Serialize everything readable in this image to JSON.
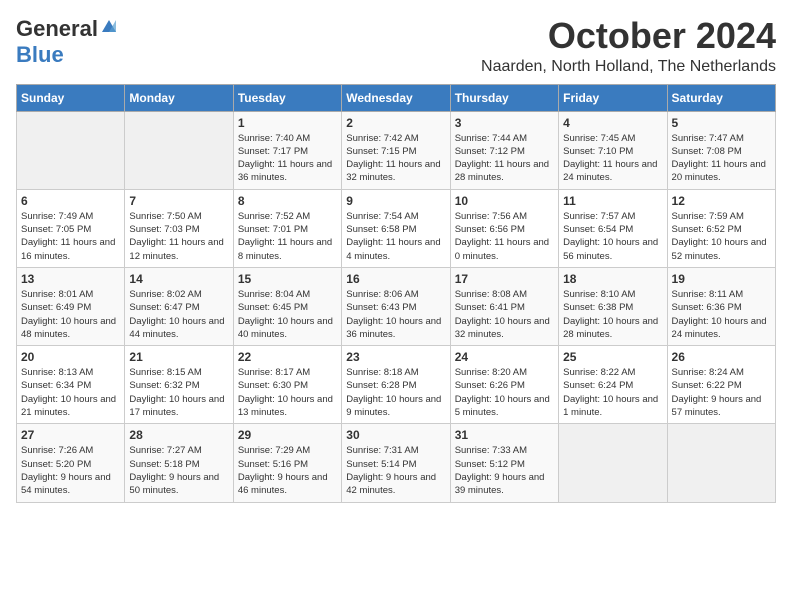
{
  "logo": {
    "general": "General",
    "blue": "Blue"
  },
  "title": "October 2024",
  "location": "Naarden, North Holland, The Netherlands",
  "days_of_week": [
    "Sunday",
    "Monday",
    "Tuesday",
    "Wednesday",
    "Thursday",
    "Friday",
    "Saturday"
  ],
  "weeks": [
    [
      {
        "day": "",
        "content": ""
      },
      {
        "day": "",
        "content": ""
      },
      {
        "day": "1",
        "content": "Sunrise: 7:40 AM\nSunset: 7:17 PM\nDaylight: 11 hours and 36 minutes."
      },
      {
        "day": "2",
        "content": "Sunrise: 7:42 AM\nSunset: 7:15 PM\nDaylight: 11 hours and 32 minutes."
      },
      {
        "day": "3",
        "content": "Sunrise: 7:44 AM\nSunset: 7:12 PM\nDaylight: 11 hours and 28 minutes."
      },
      {
        "day": "4",
        "content": "Sunrise: 7:45 AM\nSunset: 7:10 PM\nDaylight: 11 hours and 24 minutes."
      },
      {
        "day": "5",
        "content": "Sunrise: 7:47 AM\nSunset: 7:08 PM\nDaylight: 11 hours and 20 minutes."
      }
    ],
    [
      {
        "day": "6",
        "content": "Sunrise: 7:49 AM\nSunset: 7:05 PM\nDaylight: 11 hours and 16 minutes."
      },
      {
        "day": "7",
        "content": "Sunrise: 7:50 AM\nSunset: 7:03 PM\nDaylight: 11 hours and 12 minutes."
      },
      {
        "day": "8",
        "content": "Sunrise: 7:52 AM\nSunset: 7:01 PM\nDaylight: 11 hours and 8 minutes."
      },
      {
        "day": "9",
        "content": "Sunrise: 7:54 AM\nSunset: 6:58 PM\nDaylight: 11 hours and 4 minutes."
      },
      {
        "day": "10",
        "content": "Sunrise: 7:56 AM\nSunset: 6:56 PM\nDaylight: 11 hours and 0 minutes."
      },
      {
        "day": "11",
        "content": "Sunrise: 7:57 AM\nSunset: 6:54 PM\nDaylight: 10 hours and 56 minutes."
      },
      {
        "day": "12",
        "content": "Sunrise: 7:59 AM\nSunset: 6:52 PM\nDaylight: 10 hours and 52 minutes."
      }
    ],
    [
      {
        "day": "13",
        "content": "Sunrise: 8:01 AM\nSunset: 6:49 PM\nDaylight: 10 hours and 48 minutes."
      },
      {
        "day": "14",
        "content": "Sunrise: 8:02 AM\nSunset: 6:47 PM\nDaylight: 10 hours and 44 minutes."
      },
      {
        "day": "15",
        "content": "Sunrise: 8:04 AM\nSunset: 6:45 PM\nDaylight: 10 hours and 40 minutes."
      },
      {
        "day": "16",
        "content": "Sunrise: 8:06 AM\nSunset: 6:43 PM\nDaylight: 10 hours and 36 minutes."
      },
      {
        "day": "17",
        "content": "Sunrise: 8:08 AM\nSunset: 6:41 PM\nDaylight: 10 hours and 32 minutes."
      },
      {
        "day": "18",
        "content": "Sunrise: 8:10 AM\nSunset: 6:38 PM\nDaylight: 10 hours and 28 minutes."
      },
      {
        "day": "19",
        "content": "Sunrise: 8:11 AM\nSunset: 6:36 PM\nDaylight: 10 hours and 24 minutes."
      }
    ],
    [
      {
        "day": "20",
        "content": "Sunrise: 8:13 AM\nSunset: 6:34 PM\nDaylight: 10 hours and 21 minutes."
      },
      {
        "day": "21",
        "content": "Sunrise: 8:15 AM\nSunset: 6:32 PM\nDaylight: 10 hours and 17 minutes."
      },
      {
        "day": "22",
        "content": "Sunrise: 8:17 AM\nSunset: 6:30 PM\nDaylight: 10 hours and 13 minutes."
      },
      {
        "day": "23",
        "content": "Sunrise: 8:18 AM\nSunset: 6:28 PM\nDaylight: 10 hours and 9 minutes."
      },
      {
        "day": "24",
        "content": "Sunrise: 8:20 AM\nSunset: 6:26 PM\nDaylight: 10 hours and 5 minutes."
      },
      {
        "day": "25",
        "content": "Sunrise: 8:22 AM\nSunset: 6:24 PM\nDaylight: 10 hours and 1 minute."
      },
      {
        "day": "26",
        "content": "Sunrise: 8:24 AM\nSunset: 6:22 PM\nDaylight: 9 hours and 57 minutes."
      }
    ],
    [
      {
        "day": "27",
        "content": "Sunrise: 7:26 AM\nSunset: 5:20 PM\nDaylight: 9 hours and 54 minutes."
      },
      {
        "day": "28",
        "content": "Sunrise: 7:27 AM\nSunset: 5:18 PM\nDaylight: 9 hours and 50 minutes."
      },
      {
        "day": "29",
        "content": "Sunrise: 7:29 AM\nSunset: 5:16 PM\nDaylight: 9 hours and 46 minutes."
      },
      {
        "day": "30",
        "content": "Sunrise: 7:31 AM\nSunset: 5:14 PM\nDaylight: 9 hours and 42 minutes."
      },
      {
        "day": "31",
        "content": "Sunrise: 7:33 AM\nSunset: 5:12 PM\nDaylight: 9 hours and 39 minutes."
      },
      {
        "day": "",
        "content": ""
      },
      {
        "day": "",
        "content": ""
      }
    ]
  ]
}
